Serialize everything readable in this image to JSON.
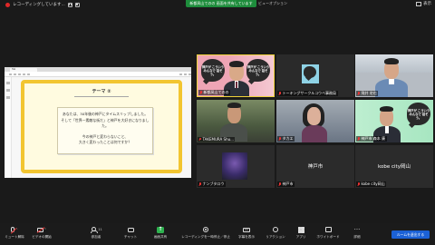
{
  "recording": {
    "text": "レコーディングしています..."
  },
  "top_banner": {
    "text": "新都凤山てのの 画面を共有しています"
  },
  "view_options": "ビューオプション",
  "display_button": "表示",
  "shared_screen": {
    "tab_title": "Tab",
    "slide": {
      "theme": "テーマ ②",
      "line1": "あなたは、30年後の神戸にタイムスリップしました。",
      "line2": "そして「世界一素敵な街だ」と神戸を大好きになりました。",
      "line3": "今の神戸と変わらないこと、",
      "line4": "大きく変わったことは何ですか？"
    }
  },
  "poster": {
    "text": "神戸が こういう みんなで 話そう。"
  },
  "tiles": [
    {
      "id": "host",
      "name": "新都凤山てのの"
    },
    {
      "id": "poster1",
      "name": "トーキングサークルコウベ事務局"
    },
    {
      "id": "man-blue",
      "name": "飛井 宅也"
    },
    {
      "id": "man-outdoor",
      "name": "TAKEMURA Shu..."
    },
    {
      "id": "woman",
      "name": "タカエ"
    },
    {
      "id": "man-suit",
      "name": "神戸市 森本 康"
    },
    {
      "id": "nanba",
      "name": "ナンブタロウ"
    },
    {
      "id": "kobe",
      "name": "神戸市",
      "center": "神戸市"
    },
    {
      "id": "kobecity",
      "name": "kobe city岡山",
      "center": "kobe city岡山"
    }
  ],
  "toolbar": {
    "unmute": "ミュート解除",
    "video": "ビデオの開始",
    "participants": "参加者",
    "participants_count": "11",
    "chat": "チャット",
    "share": "画面共有",
    "record": "レコーディングを一時停止／停止",
    "cc": "字幕を表示",
    "reactions": "リアクション",
    "apps": "アプリ",
    "whiteboard": "ホワイトボード",
    "more": "詳細",
    "end": "ルームを退出する"
  },
  "colors": {
    "share_green": "#1e8d3c",
    "slide_border": "#f2c531",
    "end_blue": "#1b61d6",
    "speaker_highlight": "#f0d23a"
  }
}
